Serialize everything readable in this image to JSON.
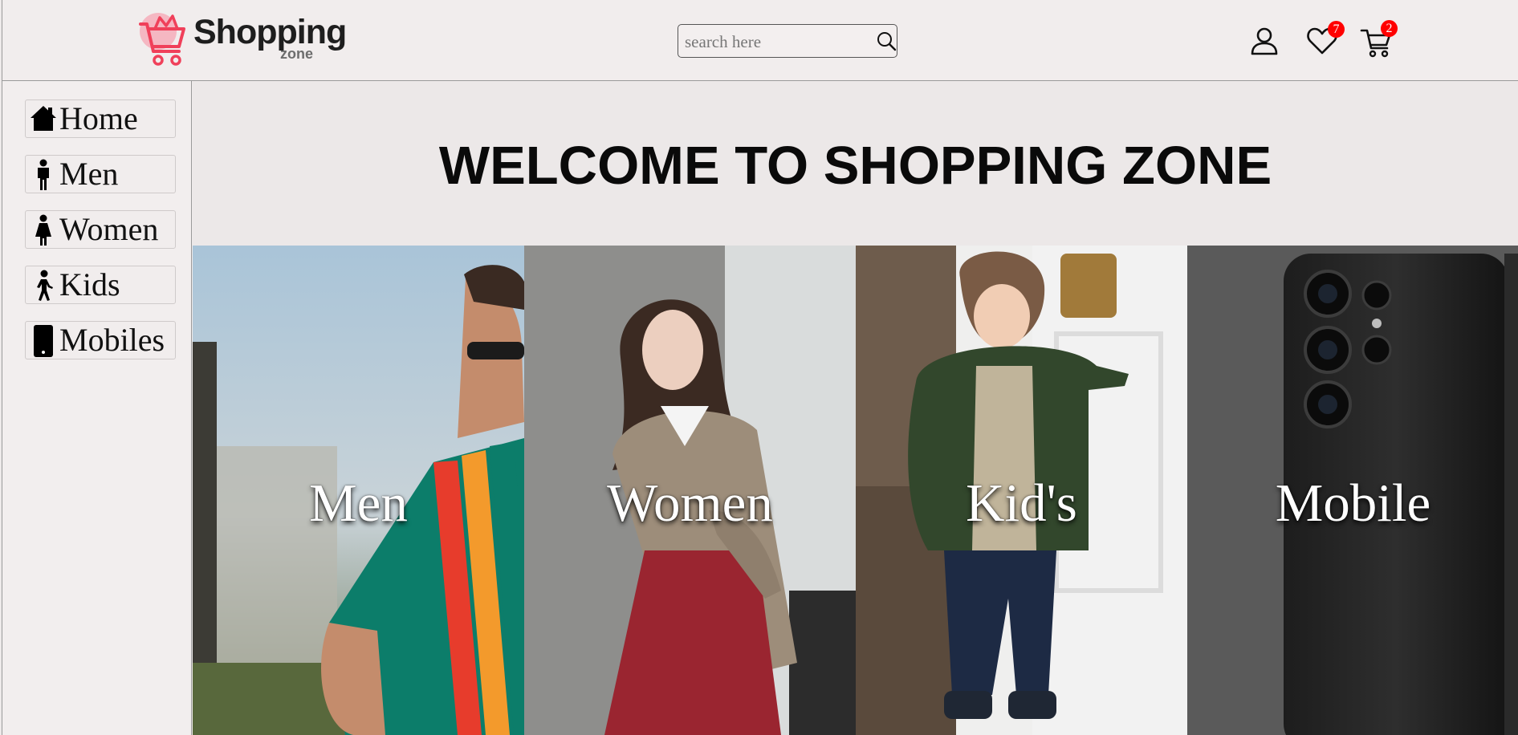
{
  "header": {
    "logo": {
      "title": "Shopping",
      "subtitle": "zone"
    },
    "search": {
      "placeholder": "search here"
    },
    "icons": {
      "account": "user-icon",
      "wishlist": "heart-icon",
      "cart": "cart-icon",
      "search": "magnifier-icon"
    },
    "wishlist_count": "7",
    "cart_count": "2"
  },
  "sidebar": {
    "items": [
      {
        "label": "Home",
        "icon": "home-icon"
      },
      {
        "label": "Men",
        "icon": "man-icon"
      },
      {
        "label": "Women",
        "icon": "woman-icon"
      },
      {
        "label": "Kids",
        "icon": "walking-child-icon"
      },
      {
        "label": "Mobiles",
        "icon": "mobile-phone-icon"
      }
    ]
  },
  "main": {
    "welcome": "WELCOME TO SHOPPING ZONE",
    "categories": [
      {
        "label": "Men"
      },
      {
        "label": "Women"
      },
      {
        "label": "Kid's"
      },
      {
        "label": "Mobile"
      }
    ]
  },
  "colors": {
    "badge": "#ff0000",
    "logo_accent": "#f0405a",
    "background": "#eeeaea"
  }
}
